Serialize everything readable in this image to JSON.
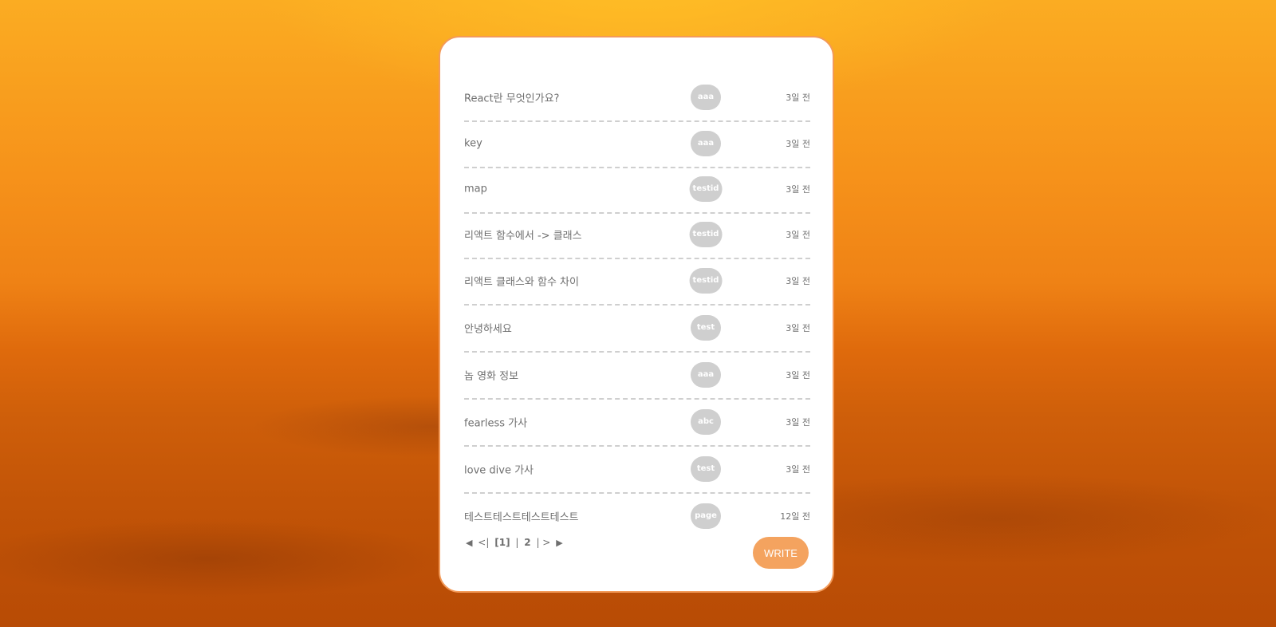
{
  "posts": [
    {
      "title": "React란 무엇인가요?",
      "author": "aaa",
      "date": "3일 전"
    },
    {
      "title": "key",
      "author": "aaa",
      "date": "3일 전"
    },
    {
      "title": "map",
      "author": "testid",
      "date": "3일 전"
    },
    {
      "title": "리액트 함수에서 -> 클래스",
      "author": "testid",
      "date": "3일 전"
    },
    {
      "title": "리액트 클래스와 함수 차이",
      "author": "testid",
      "date": "3일 전"
    },
    {
      "title": "안녕하세요",
      "author": "test",
      "date": "3일 전"
    },
    {
      "title": "놉 영화 정보",
      "author": "aaa",
      "date": "3일 전"
    },
    {
      "title": "fearless 가사",
      "author": "abc",
      "date": "3일 전"
    },
    {
      "title": "love dive 가사",
      "author": "test",
      "date": "3일 전"
    },
    {
      "title": "테스트테스트테스트테스트",
      "author": "page",
      "date": "12일 전"
    }
  ],
  "pagination": {
    "first_icon": "triangle-left-icon",
    "prev": "<|",
    "current": "[1]",
    "separator": "|",
    "page": "2",
    "next": "| >",
    "last_icon": "triangle-right-icon"
  },
  "write_button": "WRITE",
  "colors": {
    "accent": "#f4a35f",
    "card_border": "#f39a59",
    "badge": "#cfcfcf",
    "text": "#6f6f6f"
  }
}
